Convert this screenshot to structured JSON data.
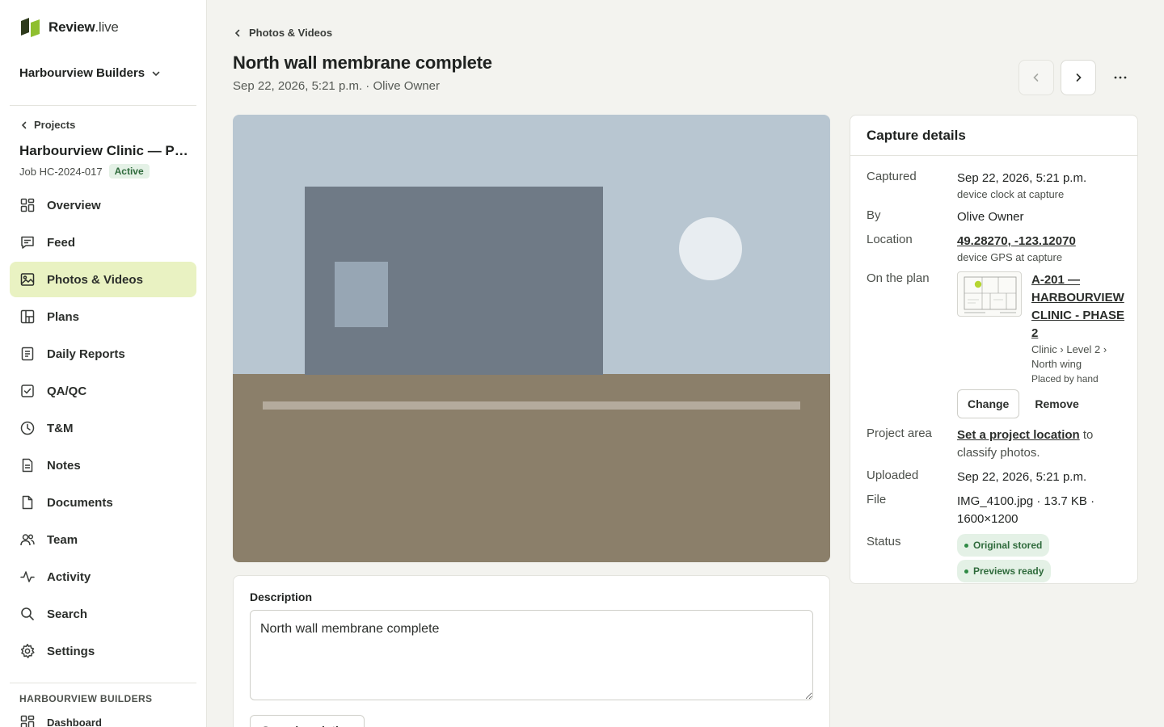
{
  "brand": {
    "name_bold": "Review",
    "name_light": ".live"
  },
  "org": {
    "name": "Harbourview Builders"
  },
  "project": {
    "back_label": "Projects",
    "name": "Harbourview Clinic — Phase 2",
    "job": "Job HC-2024-017",
    "status": "Active"
  },
  "nav": [
    {
      "label": "Overview",
      "icon": "overview-icon"
    },
    {
      "label": "Feed",
      "icon": "feed-icon"
    },
    {
      "label": "Photos & Videos",
      "icon": "photo-icon",
      "active": true
    },
    {
      "label": "Plans",
      "icon": "plans-icon"
    },
    {
      "label": "Daily Reports",
      "icon": "report-icon"
    },
    {
      "label": "QA/QC",
      "icon": "checkbox-icon"
    },
    {
      "label": "T&M",
      "icon": "clock-icon"
    },
    {
      "label": "Notes",
      "icon": "notes-icon"
    },
    {
      "label": "Documents",
      "icon": "document-icon"
    },
    {
      "label": "Team",
      "icon": "team-icon"
    },
    {
      "label": "Activity",
      "icon": "activity-icon"
    },
    {
      "label": "Search",
      "icon": "search-icon"
    },
    {
      "label": "Settings",
      "icon": "gear-icon"
    }
  ],
  "org_section": {
    "label": "HARBOURVIEW BUILDERS",
    "dashboard": "Dashboard"
  },
  "page": {
    "breadcrumb": "Photos & Videos",
    "title": "North wall membrane complete",
    "subtitle": "Sep 22, 2026, 5:21 p.m. · Olive Owner"
  },
  "description": {
    "label": "Description",
    "value": "North wall membrane complete",
    "save_label": "Save description"
  },
  "details": {
    "heading": "Capture details",
    "captured_label": "Captured",
    "captured": "Sep 22, 2026, 5:21 p.m.",
    "captured_note": "device clock at capture",
    "by_label": "By",
    "by": "Olive Owner",
    "location_label": "Location",
    "location": "49.28270, -123.12070",
    "location_note": "device GPS at capture",
    "plan_label": "On the plan",
    "plan_title": "A-201 — HARBOURVIEW CLINIC - PHASE 2",
    "plan_path": "Clinic › Level 2 › North wing",
    "plan_note": "Placed by hand",
    "change_label": "Change",
    "remove_label": "Remove",
    "area_label": "Project area",
    "area_link": "Set a project location",
    "area_rest": " to classify photos.",
    "uploaded_label": "Uploaded",
    "uploaded": "Sep 22, 2026, 5:21 p.m.",
    "file_label": "File",
    "file": "IMG_4100.jpg · 13.7 KB · 1600×1200",
    "status_label": "Status",
    "status_1": "Original stored",
    "status_2": "Previews ready"
  },
  "colors": {
    "accent": "#e9f2c2",
    "brand": "#7aa32a",
    "success": "#2f6b3c"
  }
}
